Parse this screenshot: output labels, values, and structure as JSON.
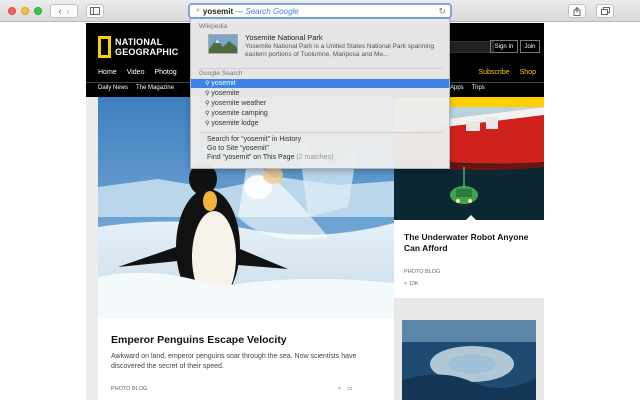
{
  "browser": {
    "address_query": "yosemit",
    "address_hint": "— Search Google"
  },
  "site": {
    "logo_line1": "NATIONAL",
    "logo_line2": "GEOGRAPHIC",
    "sign_in": "Sign In",
    "join": "Join",
    "nav_primary": [
      "Home",
      "Video",
      "Photog"
    ],
    "nav_primary_right": [
      "Subscribe",
      "Shop"
    ],
    "nav_secondary": [
      "Daily News",
      "The Magazine"
    ],
    "nav_secondary_right": [
      "Apps",
      "Trips"
    ],
    "accent_color": "#ffce00"
  },
  "dropdown": {
    "wiki_section": "Wikipedia",
    "wiki_title": "Yosemite National Park",
    "wiki_desc": "Yosemite National Park is a United States National Park spanning eastern portions of Tuolumne, Mariposa and Me...",
    "google_section": "Google Search",
    "suggestions": [
      "yosemit",
      "yosemite",
      "yosemite weather",
      "yosemite camping",
      "yosemite lodge"
    ],
    "history_label": "Search for “yosemit” in History",
    "goto_label": "Go to Site “yosemit”",
    "find_label": "Find “yosemit” on This Page",
    "find_count": "(2 matches)"
  },
  "main_article": {
    "title": "Emperor Penguins Escape Velocity",
    "desc": "Awkward on land, emperor penguins soar through the sea. Now scientists have discovered the secret of their speed.",
    "category": "PHOTO BLOG"
  },
  "side_article": {
    "title": "The Underwater Robot Anyone Can Afford",
    "category": "PHOTO BLOG",
    "share": "< 13K"
  }
}
